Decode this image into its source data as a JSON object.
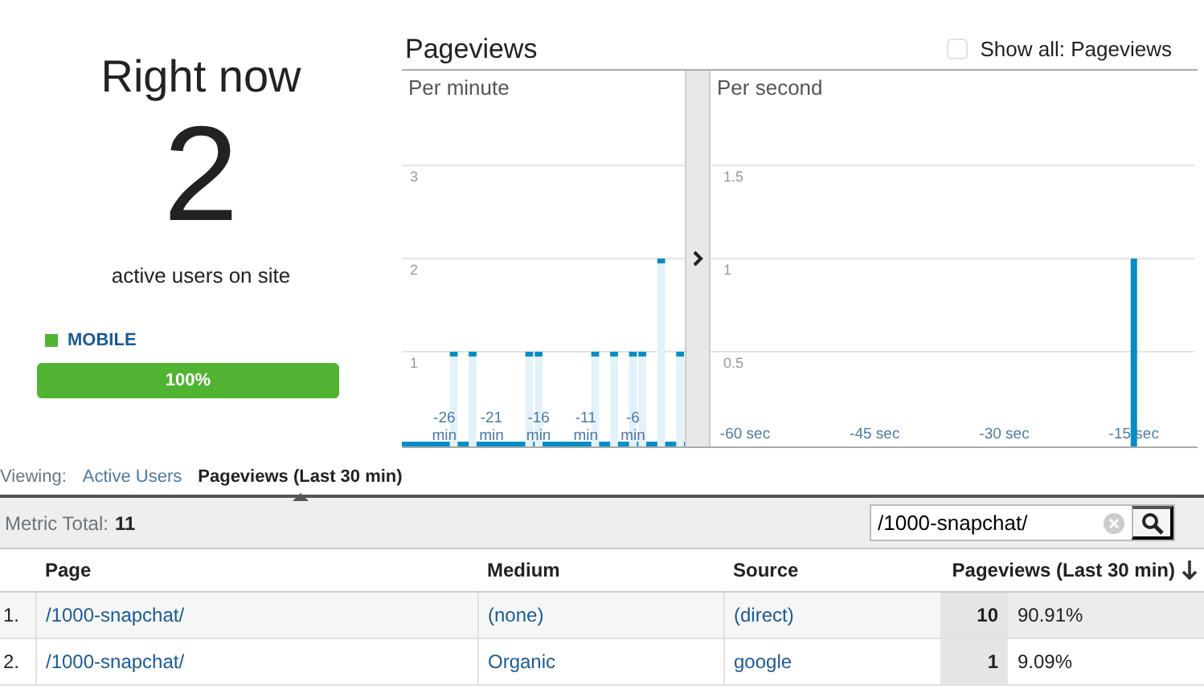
{
  "summary": {
    "title": "Right now",
    "count": "2",
    "caption": "active users on site",
    "devices": [
      {
        "label": "MOBILE",
        "color": "#50b432",
        "level": 1,
        "reading": "100%"
      }
    ]
  },
  "pageviews": {
    "title": "Pageviews",
    "show_all": {
      "label": "Show all: Pageviews",
      "checked": false
    },
    "per_minute": {
      "chart_data": {
        "type": "bar",
        "title": "Per minute",
        "x": [
          -30,
          -29,
          -28,
          -27,
          -26,
          -25,
          -24,
          -23,
          -22,
          -21,
          -20,
          -19,
          -18,
          -17,
          -16,
          -15,
          -14,
          -13,
          -12,
          -11,
          -10,
          -9,
          -8,
          -7,
          -6,
          -5,
          -4,
          -3,
          -2,
          -1
        ],
        "values": [
          0,
          0,
          0,
          0,
          0,
          1,
          0,
          1,
          0,
          0,
          0,
          0,
          0,
          1,
          1,
          0,
          0,
          0,
          0,
          0,
          1,
          0,
          1,
          0,
          1,
          1,
          0,
          2,
          0,
          1
        ],
        "xlim": [
          -30.5,
          -0.5
        ],
        "ylim": [
          0,
          3
        ],
        "grid": true,
        "yticks": [
          1,
          2,
          3
        ],
        "xticks": [
          {
            "value": -26,
            "label": "-26 min"
          },
          {
            "value": -21,
            "label": "-21 min"
          },
          {
            "value": -16,
            "label": "-16 min"
          },
          {
            "value": -11,
            "label": "-11 min"
          },
          {
            "value": -6,
            "label": "-6 min"
          }
        ]
      }
    },
    "per_second": {
      "chart_data": {
        "type": "bar",
        "title": "Per second",
        "x": [
          -15
        ],
        "values": [
          1
        ],
        "xlim": [
          -64,
          -8
        ],
        "ylim": [
          0,
          2
        ],
        "grid": true,
        "yticks": [
          0.5,
          1,
          1.5
        ],
        "xticks": [
          {
            "value": -60,
            "label": "-60 sec"
          },
          {
            "value": -45,
            "label": "-45 sec"
          },
          {
            "value": -30,
            "label": "-30 sec"
          },
          {
            "value": -15,
            "label": "-15 sec"
          }
        ]
      }
    }
  },
  "viewing": {
    "label": "Viewing:",
    "tabs": [
      {
        "label": "Active Users",
        "selected": false
      },
      {
        "label": "Pageviews (Last 30 min)",
        "selected": true
      }
    ]
  },
  "toolbar": {
    "metric_label": "Metric Total:",
    "metric_value": "11",
    "search_value": "/1000-snapchat/"
  },
  "table": {
    "columns": [
      "Page",
      "Medium",
      "Source",
      "Pageviews (Last 30 min)"
    ],
    "rows": [
      {
        "index": "1.",
        "page": "/1000-snapchat/",
        "medium": "(none)",
        "source": "(direct)",
        "pageviews": "10",
        "percent": "90.91%"
      },
      {
        "index": "2.",
        "page": "/1000-snapchat/",
        "medium": "Organic",
        "source": "google",
        "pageviews": "1",
        "percent": "9.09%"
      }
    ]
  }
}
